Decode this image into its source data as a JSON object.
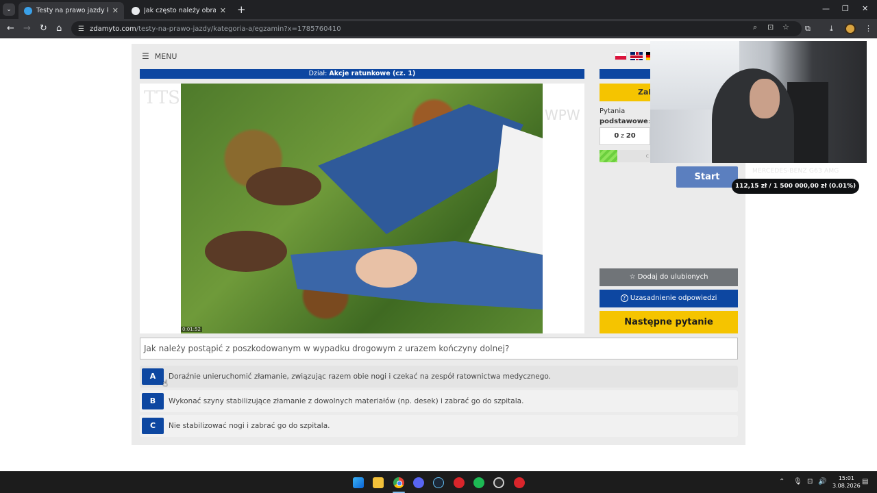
{
  "browser": {
    "tabs": [
      {
        "title": "Testy na prawo jazdy kategoria",
        "active": true
      },
      {
        "title": "Jak często należy obracać pozio",
        "active": false
      }
    ],
    "url_host": "zdamyto.com",
    "url_path": "/testy-na-prawo-jazdy/kategoria-a/egzamin?x=1785760410",
    "icons": {
      "tab_menu": "⌄",
      "tab_close": "✕",
      "new_tab": "+",
      "minimize": "—",
      "restore": "❐",
      "close": "✕",
      "back": "←",
      "forward": "→",
      "reload": "↻",
      "home": "⌂",
      "tune": "☰",
      "zoom": "⌕",
      "install": "⊡",
      "star": "☆",
      "extensions": "⧉",
      "download": "⤓",
      "more": "⋮"
    }
  },
  "page": {
    "menu_label": "MENU",
    "menu_icon": "☰",
    "section_prefix": "Dział: ",
    "section_name": "Akcje ratunkowe (cz. 1)",
    "watermark_left": "TTS",
    "watermark_right": "WPW",
    "video_timecode": "0:01:52",
    "right_yellow_label": "Zak",
    "questions_label_line1": "Pytania",
    "questions_label_line2": "podstawowe",
    "questions_label_colon": ":",
    "counter_current": "0",
    "counter_sep": " z ",
    "counter_total": "20",
    "progress_tail": "c",
    "start_label": "Start",
    "fav_icon": "☆",
    "fav_label": "Dodaj do ulubionych",
    "explain_icon": "?",
    "explain_label": "Uzasadnienie odpowiedzi",
    "next_label": "Następne pytanie",
    "question_text": "Jak należy postąpić z poszkodowanym w wypadku drogowym z urazem kończyny dolnej?",
    "answers": [
      {
        "letter": "A",
        "text": "Doraźnie unieruchomić złamanie, związując razem obie nogi i czekać na zespół ratownictwa medycznego."
      },
      {
        "letter": "B",
        "text": "Wykonać szyny stabilizujące złamanie z dowolnych materiałów (np. desek) i zabrać go do szpitala."
      },
      {
        "letter": "C",
        "text": "Nie stabilizować nogi i zabrać go do szpitala."
      }
    ]
  },
  "stream_overlay": {
    "title": "MERCEDES-BENZ G63 AMG",
    "donation": "112,15 zł / 1 500 000,00 zł (0.01%)",
    "goal_progress_percent": 0.01
  },
  "taskbar": {
    "tray_icons": [
      "⌃",
      "🎙",
      "⊡",
      "🔊"
    ],
    "time": "15:01",
    "date": "3.08.2026",
    "notification_icon": "▤"
  },
  "colors": {
    "accent_blue": "#0d47a1",
    "accent_yellow": "#f5c400",
    "progress_green": "#6ccf3e"
  }
}
